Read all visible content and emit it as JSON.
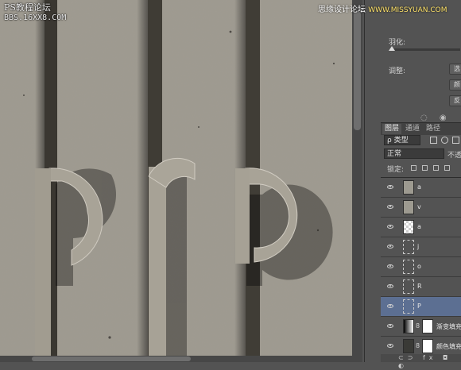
{
  "watermark": {
    "line1": "PS教程论坛",
    "line2": "BBS.16XX8.COM"
  },
  "banner": {
    "text": "思缘设计论坛",
    "site": "WWW.MISSYUAN.COM"
  },
  "properties": {
    "feather_label": "羽化:",
    "adjust_label": "调整:",
    "buttons": [
      "选",
      "颜",
      "反"
    ]
  },
  "colors": {
    "canvas_bg": "#9f9a8e",
    "panel_bg": "#535353",
    "selected_layer": "#5c6f92"
  },
  "layers_panel": {
    "tabs": [
      {
        "label": "图层"
      },
      {
        "label": "通道"
      },
      {
        "label": "路径"
      }
    ],
    "filter_kind": "ρ 类型",
    "blend_mode": "正常",
    "opacity_label": "不透明",
    "lock_label": "锁定:",
    "layers": [
      {
        "name": "a",
        "thumb": "plain"
      },
      {
        "name": "v",
        "thumb": "plain"
      },
      {
        "name": "a",
        "thumb": "checker"
      },
      {
        "name": "j",
        "thumb": "shape"
      },
      {
        "name": "o",
        "thumb": "shape"
      },
      {
        "name": "R",
        "thumb": "shape"
      },
      {
        "name": "P",
        "thumb": "shape",
        "selected": true
      },
      {
        "name": "渐变填充",
        "thumb": "grad",
        "mask": true
      },
      {
        "name": "颜色填充",
        "thumb": "dark",
        "mask": true
      }
    ]
  }
}
